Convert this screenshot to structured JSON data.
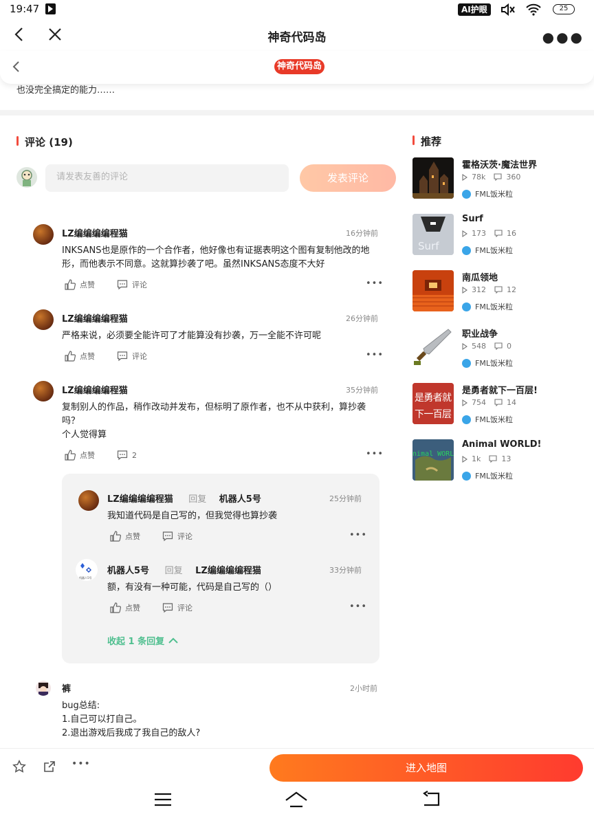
{
  "status": {
    "time": "19:47",
    "ai_label": "AI护眼",
    "battery": "25"
  },
  "topbar": {
    "title": "神奇代码岛"
  },
  "header": {
    "logo": "神奇代码岛"
  },
  "snippet": "也没完全搞定的能力……",
  "comments_section": {
    "title": "评论 (19)",
    "input_placeholder": "请发表友善的评论",
    "post_button": "发表评论",
    "like_label": "点赞",
    "comment_label": "评论",
    "items": [
      {
        "name": "LZ编编编编程猫",
        "time": "16分钟前",
        "text": "INKSANS也是原作的一个合作者，他好像也有证据表明这个图有复制他改的地形，而他表示不同意。这就算抄袭了吧。虽然INKSANS态度不大好"
      },
      {
        "name": "LZ编编编编程猫",
        "time": "26分钟前",
        "text": "严格来说，必须要全能许可了才能算没有抄袭，万一全能不许可呢"
      },
      {
        "name": "LZ编编编编程猫",
        "time": "35分钟前",
        "text": "复制别人的作品，稍作改动并发布，但标明了原作者，也不从中获利，算抄袭吗？",
        "text2": "个人觉得算",
        "reply_count": "2"
      },
      {
        "name": "裤",
        "time": "2小时前",
        "text": "bug总结:",
        "line2": "1.自己可以打自己。",
        "line3": "2.退出游戏后我成了我自己的敌人?"
      }
    ],
    "replies": [
      {
        "name": "LZ编编编编程猫",
        "reply_word": "回复",
        "target": "机器人5号",
        "time": "25分钟前",
        "text": "我知道代码是自己写的，但我觉得也算抄袭"
      },
      {
        "name": "机器人5号",
        "reply_word": "回复",
        "target": "LZ编编编编程猫",
        "time": "33分钟前",
        "text": "额，有没有一种可能，代码是自己写的（）"
      }
    ],
    "collapse_label": "收起 1 条回复"
  },
  "recommend": {
    "title": "推荐",
    "items": [
      {
        "title": "霍格沃茨·魔法世界",
        "plays": "78k",
        "comments": "360",
        "author": "FML饭米粒"
      },
      {
        "title": "Surf",
        "plays": "173",
        "comments": "16",
        "author": "FML饭米粒"
      },
      {
        "title": "南瓜领地",
        "plays": "312",
        "comments": "12",
        "author": "FML饭米粒"
      },
      {
        "title": "职业战争",
        "plays": "548",
        "comments": "0",
        "author": "FML饭米粒"
      },
      {
        "title": "是勇者就下一百层!",
        "plays": "754",
        "comments": "14",
        "author": "FML饭米粒"
      },
      {
        "title": "Animal WORLD!",
        "plays": "1k",
        "comments": "13",
        "author": "FML饭米粒"
      }
    ],
    "thumb_texts": {
      "surf": "Surf",
      "brave": "是勇者就下一百层",
      "animal": "Animal WORLD"
    }
  },
  "bottom": {
    "enter_button": "进入地图"
  },
  "colors": {
    "accent": "#ff4b2f",
    "green": "#4fbf8f",
    "like_grey": "#666666"
  }
}
